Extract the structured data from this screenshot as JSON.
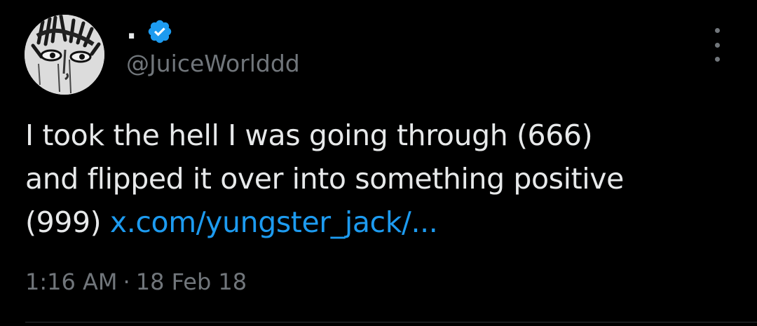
{
  "author": {
    "display_name": ".",
    "handle": "@JuiceWorlddd",
    "verified_icon": "verified-badge-icon",
    "verified_color": "#1d9bf0"
  },
  "tweet": {
    "text_line1": "I took the hell I was going through (666)",
    "text_line2": "and flipped it over into something positive",
    "text_line3_prefix": "(999) ",
    "link_text": "x.com/yungster_jack/...",
    "time": "1:16 AM",
    "separator": "·",
    "date": "18 Feb 18"
  },
  "actions": {
    "more_icon": "more-vertical-icon"
  },
  "colors": {
    "background": "#000000",
    "text": "#e7e9ea",
    "secondary_text": "#71767b",
    "link": "#1d9bf0",
    "divider": "#2f3336"
  }
}
